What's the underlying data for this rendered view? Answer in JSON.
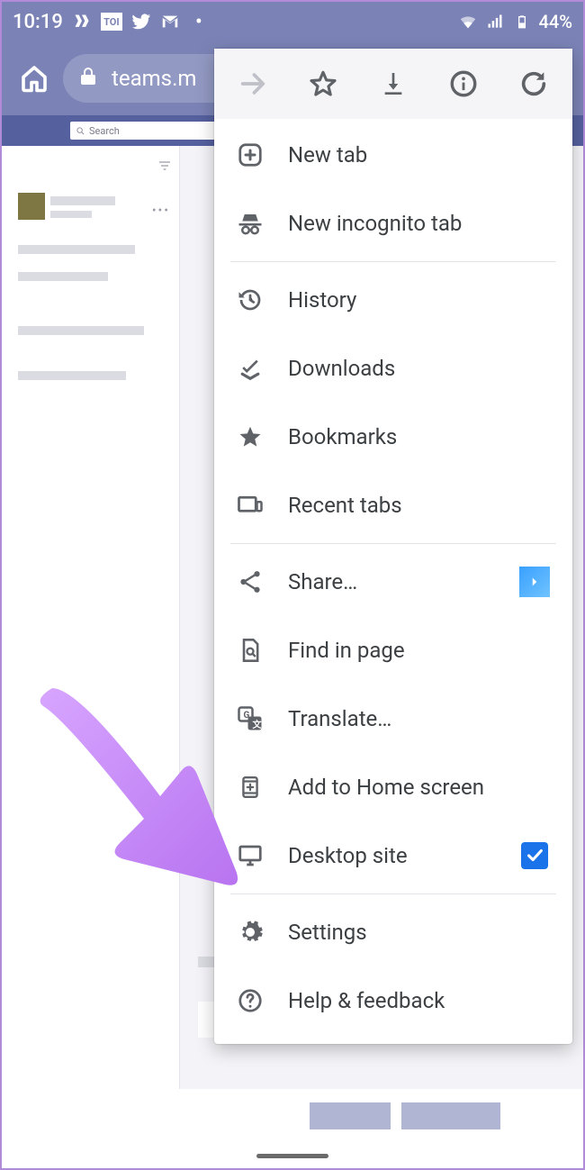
{
  "status": {
    "time": "10:19",
    "battery_pct": "44%"
  },
  "browser": {
    "url_display": "teams.m"
  },
  "page": {
    "search_placeholder": "Search"
  },
  "menu": {
    "items": {
      "new_tab": "New tab",
      "incognito": "New incognito tab",
      "history": "History",
      "downloads": "Downloads",
      "bookmarks": "Bookmarks",
      "recent_tabs": "Recent tabs",
      "share": "Share…",
      "find": "Find in page",
      "translate": "Translate…",
      "add_home": "Add to Home screen",
      "desktop": "Desktop site",
      "settings": "Settings",
      "help": "Help & feedback"
    },
    "desktop_checked": true
  }
}
